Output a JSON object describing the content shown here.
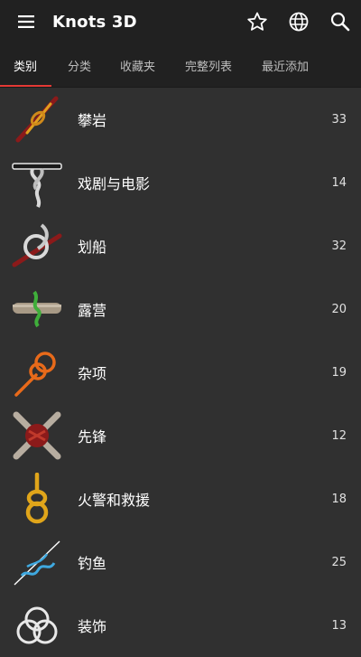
{
  "app": {
    "title": "Knots 3D"
  },
  "tabs": [
    {
      "label": "类别"
    },
    {
      "label": "分类"
    },
    {
      "label": "收藏夹"
    },
    {
      "label": "完整列表"
    },
    {
      "label": "最近添加"
    }
  ],
  "categories": [
    {
      "label": "攀岩",
      "count": "33"
    },
    {
      "label": "戏剧与电影",
      "count": "14"
    },
    {
      "label": "划船",
      "count": "32"
    },
    {
      "label": "露营",
      "count": "20"
    },
    {
      "label": "杂项",
      "count": "19"
    },
    {
      "label": "先锋",
      "count": "12"
    },
    {
      "label": "火警和救援",
      "count": "18"
    },
    {
      "label": "钓鱼",
      "count": "25"
    },
    {
      "label": "装饰",
      "count": "13"
    }
  ],
  "colors": {
    "accent": "#e53935",
    "bar": "#212121",
    "background": "#303030"
  }
}
